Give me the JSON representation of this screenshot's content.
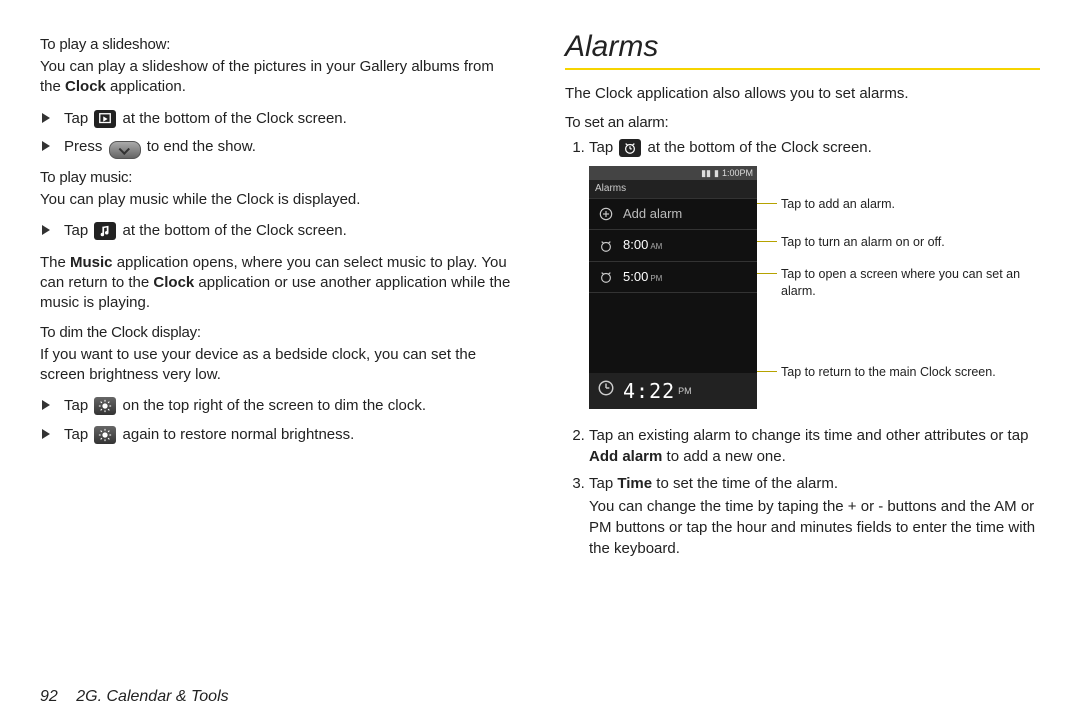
{
  "left": {
    "slideshow_head": "To play a slideshow:",
    "slideshow_intro_a": "You can play a slideshow of the pictures in your Gallery albums from the ",
    "slideshow_intro_bold": "Clock",
    "slideshow_intro_b": " application.",
    "slideshow_b1_a": "Tap ",
    "slideshow_b1_b": " at the bottom of the Clock screen.",
    "slideshow_b2_a": "Press ",
    "slideshow_b2_b": " to end the show.",
    "music_head": "To play music:",
    "music_intro": "You can play music while the Clock is displayed.",
    "music_b1_a": "Tap ",
    "music_b1_b": " at the bottom of the Clock screen.",
    "music_para_a": "The ",
    "music_para_bold1": "Music",
    "music_para_b": " application opens, where you can select music to play. You can return to the ",
    "music_para_bold2": "Clock",
    "music_para_c": " application or use another application while the music is playing.",
    "dim_head": "To dim the Clock display:",
    "dim_intro": "If you want to use your device as a bedside clock, you can set the screen brightness very low.",
    "dim_b1_a": "Tap ",
    "dim_b1_b": " on the top right of the screen to dim the clock.",
    "dim_b2_a": "Tap ",
    "dim_b2_b": " again to restore normal brightness."
  },
  "right": {
    "title": "Alarms",
    "intro": "The Clock application also allows you to set alarms.",
    "set_head": "To set an alarm:",
    "step1_a": "Tap ",
    "step1_b": " at the bottom of the Clock screen.",
    "step2_a": "Tap an existing alarm to change its time and other attributes or tap ",
    "step2_bold": "Add alarm",
    "step2_b": " to add a new one.",
    "step3_a": "Tap ",
    "step3_bold": "Time",
    "step3_b": " to set the time of the alarm.",
    "step3_para": "You can change the time by taping the + or - buttons and the AM or PM buttons or tap the hour and minutes fields to enter the time with the keyboard.",
    "callouts": {
      "c1": "Tap to add an alarm.",
      "c2": "Tap to turn an alarm on or off.",
      "c3": "Tap to open a screen where you can set an alarm.",
      "c4": "Tap to return to the main Clock screen."
    },
    "phone": {
      "status_time": "1:00PM",
      "appbar": "Alarms",
      "add_label": "Add alarm",
      "rows": [
        {
          "time": "8:00",
          "ampm": "AM"
        },
        {
          "time": "5:00",
          "ampm": "PM"
        }
      ],
      "footer_time": "4:22",
      "footer_ampm": "PM"
    }
  },
  "footer": {
    "page": "92",
    "section": "2G. Calendar & Tools"
  }
}
